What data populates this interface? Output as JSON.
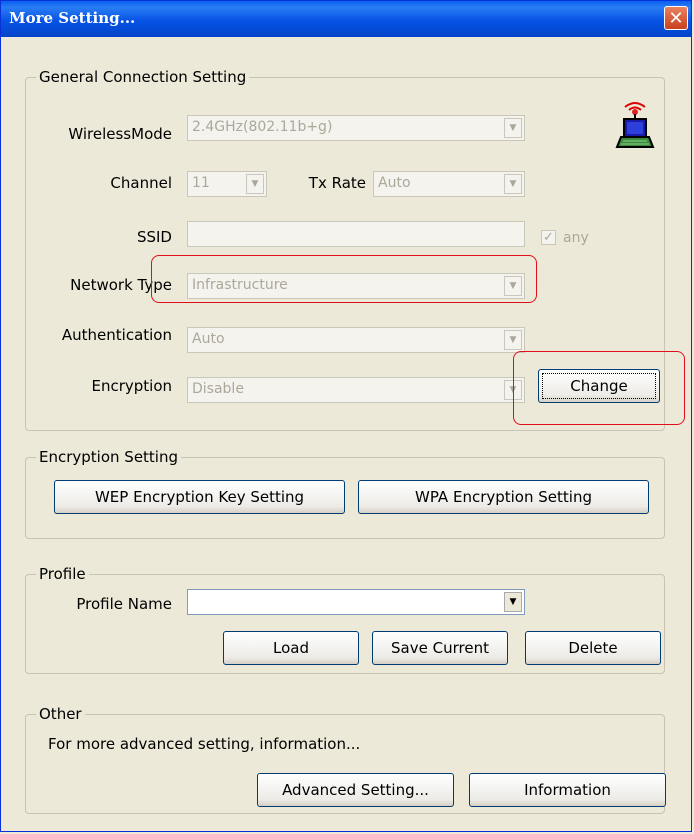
{
  "window": {
    "title": "More Setting...",
    "close_glyph": "✕"
  },
  "general": {
    "legend": "General Connection Setting",
    "wireless_mode_label": "WirelessMode",
    "wireless_mode_value": "2.4GHz(802.11b+g)",
    "channel_label": "Channel",
    "channel_value": "11",
    "tx_rate_label": "Tx Rate",
    "tx_rate_value": "Auto",
    "ssid_label": "SSID",
    "ssid_value": "",
    "any_label": "any",
    "any_checked": true,
    "network_type_label": "Network Type",
    "network_type_value": "Infrastructure",
    "authentication_label": "Authentication",
    "authentication_value": "Auto",
    "encryption_label": "Encryption",
    "encryption_value": "Disable",
    "change_button": "Change",
    "status_icon": "wireless-laptop-icon"
  },
  "encryption_setting": {
    "legend": "Encryption Setting",
    "wep_button": "WEP Encryption Key Setting",
    "wpa_button": "WPA Encryption Setting"
  },
  "profile": {
    "legend": "Profile",
    "name_label": "Profile Name",
    "name_value": "",
    "load_button": "Load",
    "save_button": "Save Current",
    "delete_button": "Delete"
  },
  "other": {
    "legend": "Other",
    "description": "For more advanced setting, information...",
    "advanced_button": "Advanced Setting...",
    "information_button": "Information"
  },
  "colors": {
    "highlight": "#e0101a",
    "titlebar": "#0653e6",
    "disabled_text": "#aca899"
  }
}
